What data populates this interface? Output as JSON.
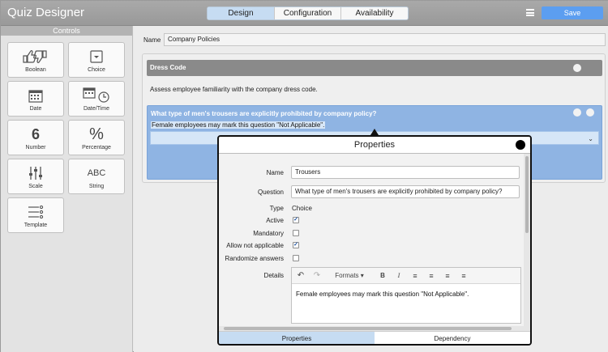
{
  "app": {
    "title": "Quiz Designer"
  },
  "header": {
    "tabs": [
      {
        "label": "Design",
        "active": true
      },
      {
        "label": "Configuration",
        "active": false
      },
      {
        "label": "Availability",
        "active": false
      }
    ],
    "save_label": "Save"
  },
  "controls": {
    "title": "Controls",
    "items": [
      {
        "label": "Boolean",
        "icon": "thumbs-up-down-icon"
      },
      {
        "label": "Choice",
        "icon": "dropdown-box-icon"
      },
      {
        "label": "Date",
        "icon": "calendar-icon"
      },
      {
        "label": "Date/Time",
        "icon": "calendar-clock-icon"
      },
      {
        "label": "Number",
        "icon": "number-six-icon",
        "glyph": "6"
      },
      {
        "label": "Percentage",
        "icon": "percent-icon",
        "glyph": "%"
      },
      {
        "label": "Scale",
        "icon": "sliders-icon"
      },
      {
        "label": "String",
        "icon": "text-abc-icon",
        "glyph": "ABC"
      },
      {
        "label": "Template",
        "icon": "list-template-icon"
      }
    ]
  },
  "main": {
    "name_label": "Name",
    "name_value": "Company Policies",
    "section": {
      "title": "Dress Code",
      "description": "Assess employee familiarity with the company dress code."
    },
    "question": {
      "title": "What type of men's trousers are explicitly prohibited by company policy?",
      "detail": "Female employees may mark this question \"Not Applicable\"."
    }
  },
  "properties": {
    "title": "Properties",
    "name_label": "Name",
    "name_value": "Trousers",
    "question_label": "Question",
    "question_value": "What type of men's trousers are explicitly prohibited by company policy?",
    "type_label": "Type",
    "type_value": "Choice",
    "active_label": "Active",
    "active_checked": true,
    "mandatory_label": "Mandatory",
    "mandatory_checked": false,
    "allow_na_label": "Allow not applicable",
    "allow_na_checked": true,
    "randomize_label": "Randomize answers",
    "randomize_checked": false,
    "details_label": "Details",
    "toolbar": {
      "formats_label": "Formats"
    },
    "details_text": "Female employees may mark this question \"Not Applicable\".",
    "tabs": [
      {
        "label": "Properties",
        "active": true
      },
      {
        "label": "Dependency",
        "active": false
      }
    ]
  },
  "colors": {
    "accent": "#5c9ef0",
    "active_tab": "#c6dcf2",
    "question_card": "#8fb4e3",
    "section_header": "#8a8a8a"
  }
}
